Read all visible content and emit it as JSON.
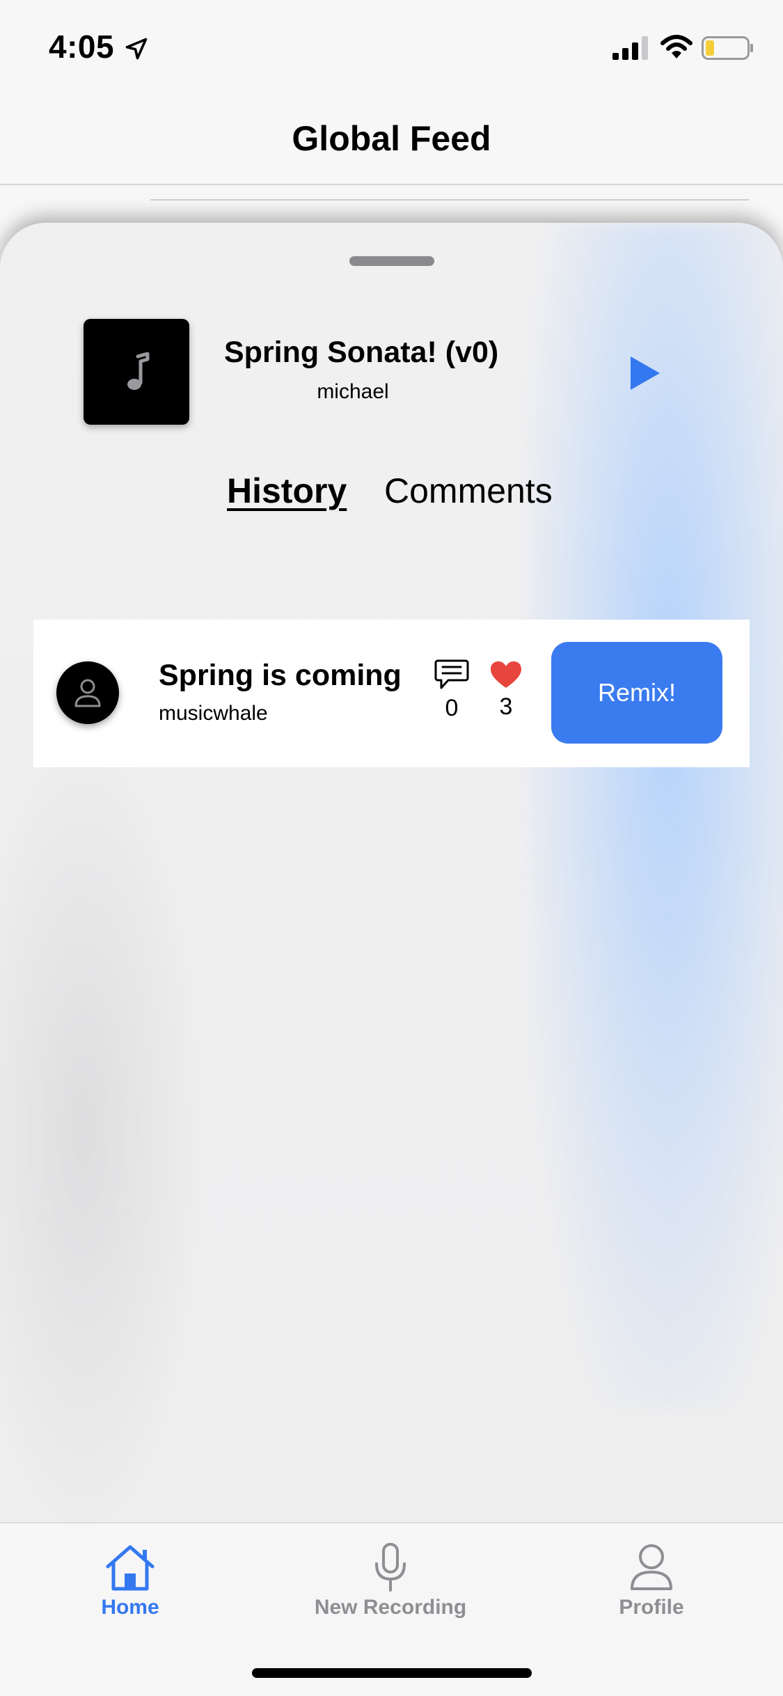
{
  "status_bar": {
    "time": "4:05",
    "icons": [
      "location-arrow-icon",
      "cellular-signal-icon",
      "wifi-icon",
      "battery-low-icon"
    ]
  },
  "header": {
    "title": "Global Feed"
  },
  "player": {
    "track_title": "Spring Sonata! (v0)",
    "artist": "michael",
    "album_art_icon": "music-note-icon",
    "play_icon": "play-icon"
  },
  "tabs": [
    {
      "label": "History",
      "selected": true
    },
    {
      "label": "Comments",
      "selected": false
    }
  ],
  "history": [
    {
      "title": "Spring is coming",
      "user": "musicwhale",
      "comments": "0",
      "likes": "3",
      "button_label": "Remix!"
    }
  ],
  "tab_bar": {
    "items": [
      {
        "label": "Home",
        "icon": "home-icon",
        "active": true
      },
      {
        "label": "New Recording",
        "icon": "microphone-icon",
        "active": false
      },
      {
        "label": "Profile",
        "icon": "person-icon",
        "active": false
      }
    ]
  },
  "colors": {
    "accent": "#3478f0",
    "remix_button": "#3a7bf0",
    "heart": "#e8453c",
    "inactive_tab": "#8e8e93"
  }
}
